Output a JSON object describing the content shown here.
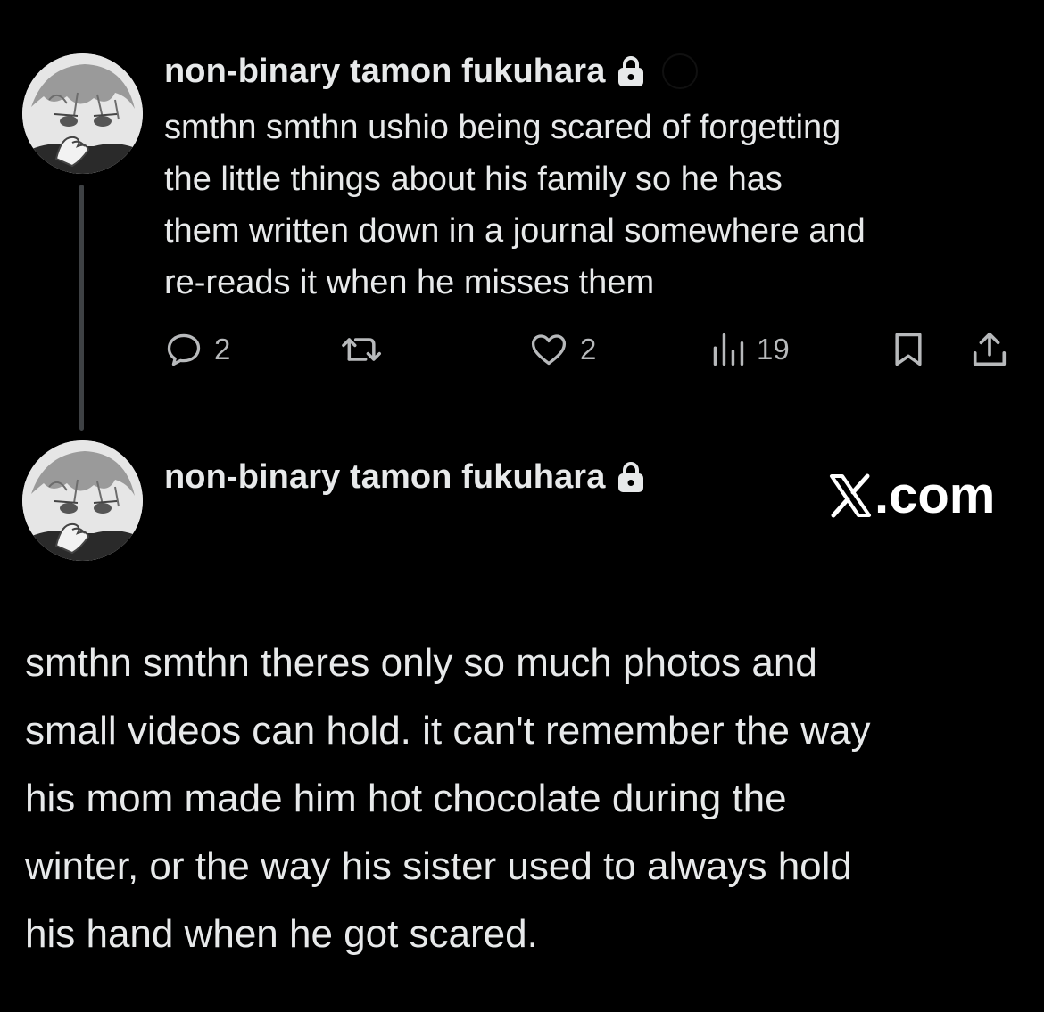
{
  "tweets": [
    {
      "author": {
        "display_name": "non-binary tamon fukuhara",
        "avatar_icon": "anime-avatar",
        "locked_icon": "lock-icon"
      },
      "text": "smthn smthn ushio being scared of forgetting\nthe little things about his family so he has\nthem written down in a journal somewhere and\nre-reads it when he misses them",
      "actions": {
        "replies": "2",
        "likes": "2",
        "views": "19"
      }
    },
    {
      "author": {
        "display_name": "non-binary tamon fukuhara",
        "avatar_icon": "anime-avatar",
        "locked_icon": "lock-icon"
      },
      "text": "smthn smthn theres only so much photos and\nsmall videos can hold. it can't remember the way\nhis mom made him hot chocolate during the\nwinter, or the way his sister used to always hold\nhis hand when he got scared."
    }
  ],
  "watermark": {
    "logo_icon": "x-logo-icon",
    "domain_suffix": ".com"
  },
  "colors": {
    "background": "#000000",
    "text": "#e7e9ea",
    "icon": "#b7b9bb",
    "thread_line": "#3e4144"
  }
}
